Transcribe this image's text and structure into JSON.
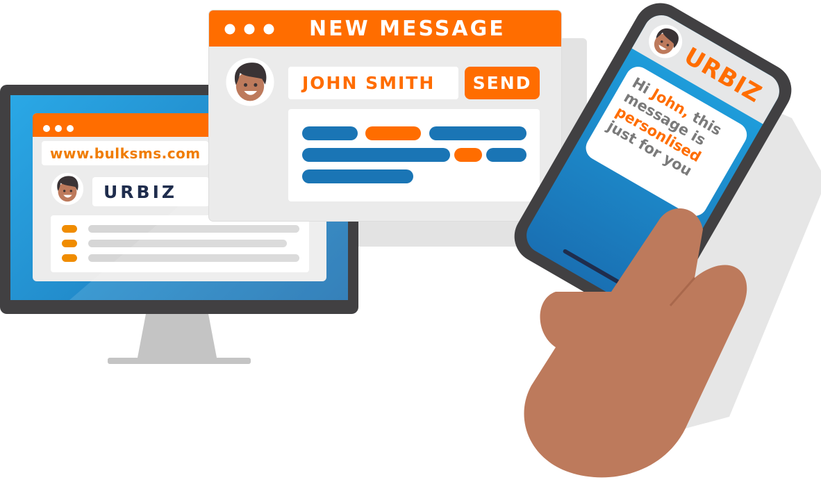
{
  "colors": {
    "orange": "#ff6d00",
    "blue": "#1f9fe0",
    "dark_blue": "#1a75b5",
    "frame": "#414042",
    "light_gray": "#ebebeb",
    "navy": "#1f2d4d",
    "skin": "#bd7a5c",
    "text_gray": "#7a7a7a"
  },
  "desktop": {
    "url": "www.bulksms.com",
    "brand": "URBIZ"
  },
  "new_message": {
    "title": "NEW MESSAGE",
    "recipient": "JOHN SMITH",
    "send_label": "SEND"
  },
  "phone": {
    "brand": "URBIZ",
    "message": {
      "greeting": "Hi ",
      "name": "John,",
      "line1_rest": " this",
      "line2": "message is",
      "line3": "personlised",
      "line4": "just for you"
    }
  },
  "icons": [
    "window-dots-icon",
    "avatar-icon",
    "hand-icon"
  ]
}
